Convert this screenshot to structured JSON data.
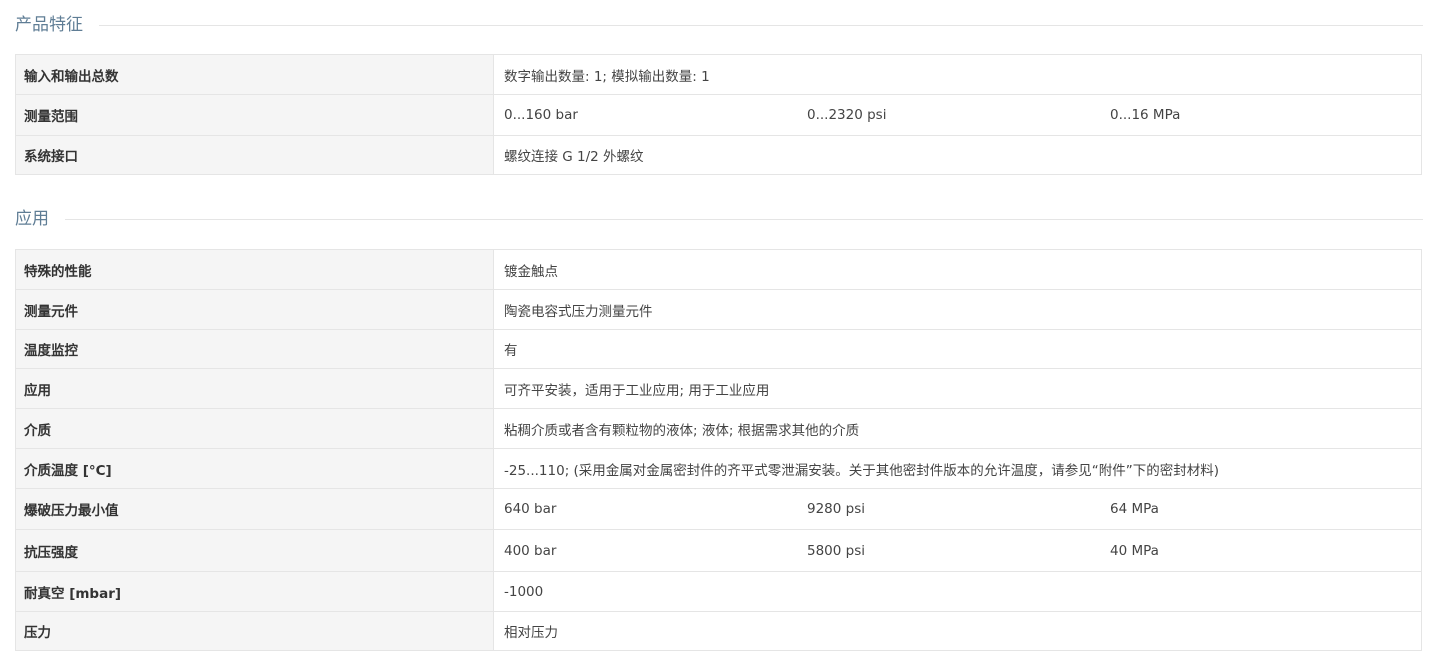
{
  "sections": [
    {
      "title": "产品特征",
      "rows": [
        {
          "label": "输入和输出总数",
          "value": "数字输出数量: 1; 模拟输出数量: 1"
        },
        {
          "label": "测量范围",
          "values": [
            "0...160 bar",
            "0...2320 psi",
            "0...16 MPa"
          ]
        },
        {
          "label": "系统接口",
          "value": "螺纹连接 G 1/2 外螺纹"
        }
      ]
    },
    {
      "title": "应用",
      "rows": [
        {
          "label": "特殊的性能",
          "value": "镀金触点"
        },
        {
          "label": "测量元件",
          "value": "陶瓷电容式压力测量元件"
        },
        {
          "label": "温度监控",
          "value": "有"
        },
        {
          "label": "应用",
          "value": "可齐平安装，适用于工业应用; 用于工业应用"
        },
        {
          "label": "介质",
          "value": "粘稠介质或者含有颗粒物的液体; 液体; 根据需求其他的介质"
        },
        {
          "label": "介质温度 [°C]",
          "value": "-25...110; (采用金属对金属密封件的齐平式零泄漏安装。关于其他密封件版本的允许温度，请参见“附件”下的密封材料)"
        },
        {
          "label": "爆破压力最小值",
          "values": [
            "640 bar",
            "9280 psi",
            "64 MPa"
          ]
        },
        {
          "label": "抗压强度",
          "values": [
            "400 bar",
            "5800 psi",
            "40 MPa"
          ]
        },
        {
          "label": "耐真空 [mbar]",
          "value": "-1000"
        },
        {
          "label": "压力",
          "value": "相对压力"
        }
      ]
    }
  ]
}
